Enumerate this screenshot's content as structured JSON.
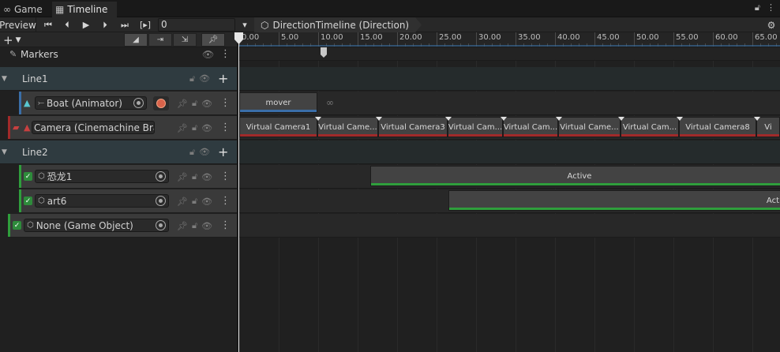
{
  "tabs": [
    {
      "label": "Game",
      "icon": "gamepad-icon",
      "active": false
    },
    {
      "label": "Timeline",
      "icon": "film-icon",
      "active": true
    }
  ],
  "toolbar": {
    "preview_label": "Preview",
    "frame_value": "0",
    "asset_label": "DirectionTimeline (Direction)"
  },
  "ruler": {
    "labels": [
      "0.00",
      "5.00",
      "10.00",
      "15.00",
      "20.00",
      "25.00",
      "30.00",
      "35.00",
      "40.00",
      "45.00",
      "50.00",
      "55.00",
      "60.00",
      "65.00"
    ]
  },
  "markers": {
    "label": "Markers"
  },
  "groups": [
    {
      "label": "Line1"
    },
    {
      "label": "Line2"
    }
  ],
  "tracks": {
    "boat": {
      "binding": "Boat (Animator)",
      "clip": "mover",
      "color": "#3a6ea8"
    },
    "camera": {
      "binding": "Camera (Cinemachine Brain",
      "color": "#a12a2a",
      "clips": [
        "Virtual Camera1",
        "Virtual Came...",
        "Virtual Camera3",
        "Virtual Cam...",
        "Virtual Cam...",
        "Virtual Came...",
        "Virtual Cam...",
        "Virtual Camera8",
        "Vi"
      ]
    },
    "dino": {
      "binding": "恐龙1",
      "clip": "Active",
      "color": "#2f9e3c"
    },
    "art6": {
      "binding": "art6",
      "clip": "Act",
      "color": "#2f9e3c"
    },
    "none": {
      "binding": "None (Game Object)",
      "color": "#2f9e3c"
    }
  },
  "colors": {
    "accent_green": "#2f9e3c",
    "accent_blue": "#3a6ea8",
    "accent_red": "#a12a2a"
  }
}
